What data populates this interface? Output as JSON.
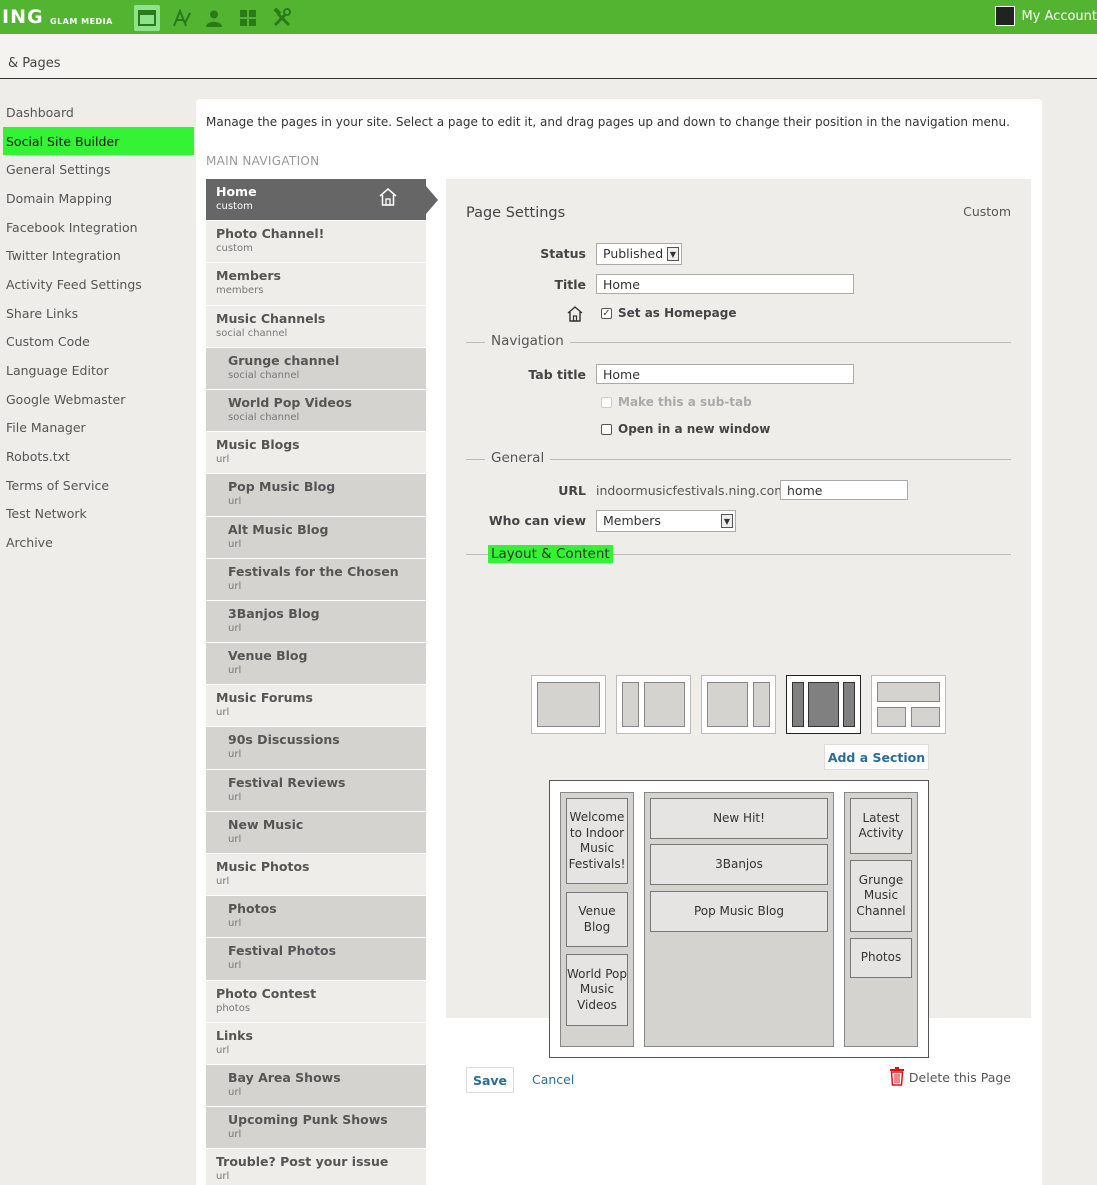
{
  "topbar": {
    "logo": "ING",
    "logo_sub": "GLAM MEDIA",
    "icons": [
      "browser-window-icon",
      "text-style-icon",
      "person-icon",
      "grid-icon",
      "tools-icon"
    ],
    "account": "My Account",
    "accent": "#53b432"
  },
  "header": {
    "title": "& Pages"
  },
  "sidebar": {
    "items": [
      {
        "label": "Dashboard"
      },
      {
        "label": "Social Site Builder",
        "active": true
      },
      {
        "label": "General Settings"
      },
      {
        "label": "Domain Mapping"
      },
      {
        "label": "Facebook Integration"
      },
      {
        "label": "Twitter Integration"
      },
      {
        "label": "Activity Feed Settings"
      },
      {
        "label": "Share Links"
      },
      {
        "label": "Custom Code"
      },
      {
        "label": "Language Editor"
      },
      {
        "label": "Google Webmaster"
      },
      {
        "label": "File Manager"
      },
      {
        "label": "Robots.txt"
      },
      {
        "label": "Terms of Service"
      },
      {
        "label": "Test Network"
      },
      {
        "label": "Archive"
      }
    ]
  },
  "main": {
    "intro": "Manage the pages in your site. Select a page to edit it, and drag pages up and down to change their position in the navigation menu.",
    "nav_label": "MAIN NAVIGATION"
  },
  "pages": [
    {
      "name": "Home",
      "type": "custom",
      "home": true
    },
    {
      "name": "Photo Channel!",
      "type": "custom"
    },
    {
      "name": "Members",
      "type": "members"
    },
    {
      "name": "Music Channels",
      "type": "social channel"
    },
    {
      "name": "Grunge channel",
      "type": "social channel",
      "sub": true
    },
    {
      "name": "World Pop Videos",
      "type": "social channel",
      "sub": true
    },
    {
      "name": "Music Blogs",
      "type": "url"
    },
    {
      "name": "Pop Music Blog",
      "type": "url",
      "sub": true
    },
    {
      "name": "Alt Music Blog",
      "type": "url",
      "sub": true
    },
    {
      "name": "Festivals for the Chosen",
      "type": "url",
      "sub": true
    },
    {
      "name": "3Banjos Blog",
      "type": "url",
      "sub": true
    },
    {
      "name": "Venue Blog",
      "type": "url",
      "sub": true
    },
    {
      "name": "Music Forums",
      "type": "url"
    },
    {
      "name": "90s Discussions",
      "type": "url",
      "sub": true
    },
    {
      "name": "Festival Reviews",
      "type": "url",
      "sub": true
    },
    {
      "name": "New Music",
      "type": "url",
      "sub": true
    },
    {
      "name": "Music Photos",
      "type": "url"
    },
    {
      "name": "Photos",
      "type": "url",
      "sub": true
    },
    {
      "name": "Festival Photos",
      "type": "url",
      "sub": true
    },
    {
      "name": "Photo Contest",
      "type": "photos"
    },
    {
      "name": "Links",
      "type": "url"
    },
    {
      "name": "Bay Area Shows",
      "type": "url",
      "sub": true
    },
    {
      "name": "Upcoming Punk Shows",
      "type": "url",
      "sub": true
    },
    {
      "name": "Trouble? Post your issue",
      "type": "url"
    }
  ],
  "settings": {
    "title": "Page Settings",
    "kind": "Custom",
    "status_label": "Status",
    "status_value": "Published",
    "title_label": "Title",
    "title_value": "Home",
    "homepage_label": "Set as Homepage",
    "homepage_checked": true,
    "navigation_section": "Navigation",
    "tab_title_label": "Tab title",
    "tab_title_value": "Home",
    "subtab_label": "Make this a sub-tab",
    "new_window_label": "Open in a new window",
    "general_section": "General",
    "url_label": "URL",
    "url_prefix": "indoormusicfestivals.ning.com/",
    "url_value": "home",
    "who_label": "Who can view",
    "who_value": "Members",
    "layout_section": "Layout & Content",
    "add_section": "Add a Section",
    "save": "Save",
    "cancel": "Cancel",
    "delete": "Delete this Page"
  },
  "layout_preview": {
    "left": [
      "Welcome to Indoor Music Festivals!",
      "Venue Blog",
      "World Pop Music Videos"
    ],
    "center": [
      "New Hit!",
      "3Banjos",
      "Pop Music Blog"
    ],
    "right": [
      "Latest Activity",
      "Grunge Music Channel",
      "Photos"
    ]
  }
}
